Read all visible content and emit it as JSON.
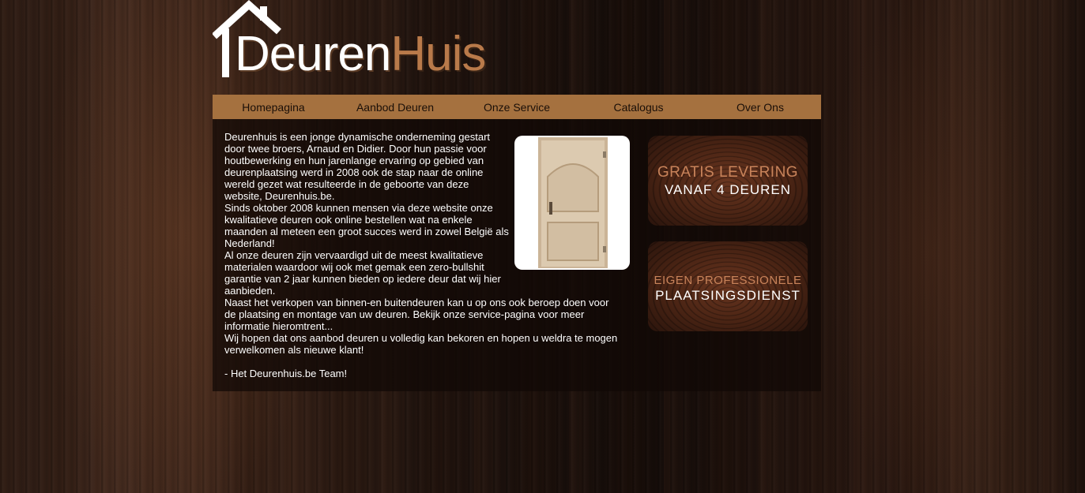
{
  "logo": {
    "part1": "Deuren",
    "part2": "Huis"
  },
  "nav": [
    "Homepagina",
    "Aanbod Deuren",
    "Onze Service",
    "Catalogus",
    "Over Ons"
  ],
  "intro": {
    "p1": "Deurenhuis is een jonge dynamische onderneming gestart door twee broers, Arnaud en Didier. Door hun passie voor houtbewerking en hun jarenlange ervaring op gebied van deurenplaatsing werd in 2008 ook de stap naar de online wereld gezet wat resulteerde in de geboorte van deze website, Deurenhuis.be.",
    "p2": "Sinds oktober 2008 kunnen mensen via deze website onze kwalitatieve deuren ook online bestellen wat na enkele maanden al meteen een groot succes werd in zowel België als Nederland!",
    "p3": "Al onze deuren zijn vervaardigd uit de meest kwalitatieve materialen waardoor wij ook met gemak een zero-bullshit garantie van 2 jaar kunnen bieden op iedere deur dat wij hier aanbieden.",
    "p4": "Naast het verkopen van binnen-en buitendeuren kan u op ons ook beroep doen voor de plaatsing en montage van uw deuren. Bekijk onze service-pagina voor meer informatie hieromtrent...",
    "p5": "Wij hopen dat ons aanbod deuren u volledig kan bekoren en hopen u weldra te mogen verwelkomen als nieuwe klant!",
    "signoff": "- Het Deurenhuis.be Team!"
  },
  "promos": [
    {
      "line1": "GRATIS LEVERING",
      "line2": "VANAF 4 DEUREN"
    },
    {
      "line1": "EIGEN PROFESSIONELE",
      "line2": "PLAATSINGSDIENST"
    }
  ],
  "colors": {
    "nav_bg": "#a5713f",
    "accent": "#b97a4a"
  }
}
